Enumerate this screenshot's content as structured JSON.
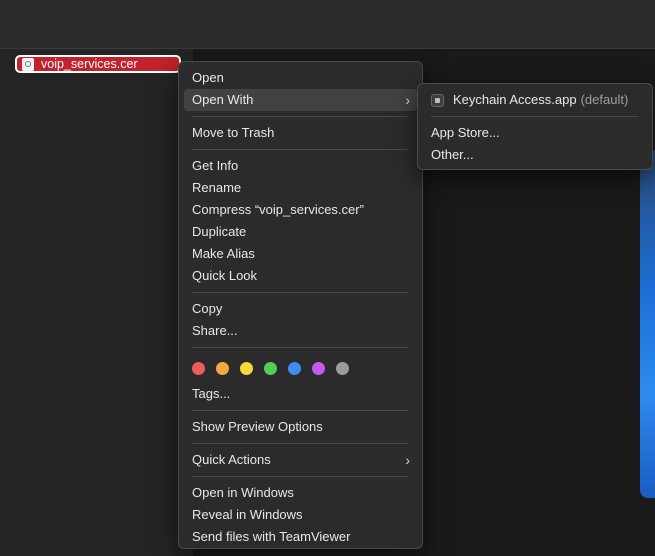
{
  "file": {
    "name": "voip_services.cer"
  },
  "context_menu": {
    "open": "Open",
    "open_with": "Open With",
    "move_to_trash": "Move to Trash",
    "get_info": "Get Info",
    "rename": "Rename",
    "compress": "Compress “voip_services.cer”",
    "duplicate": "Duplicate",
    "make_alias": "Make Alias",
    "quick_look": "Quick Look",
    "copy": "Copy",
    "share": "Share...",
    "tags": "Tags...",
    "tag_colors": [
      "#f05a5a",
      "#f5a93b",
      "#f7d93a",
      "#4fcf55",
      "#3f8cf5",
      "#c35bf0",
      "#9b9b9b"
    ],
    "show_preview_options": "Show Preview Options",
    "quick_actions": "Quick Actions",
    "open_in_windows": "Open in Windows",
    "reveal_in_windows": "Reveal in Windows",
    "send_with_teamviewer": "Send files with TeamViewer"
  },
  "open_with_submenu": {
    "keychain_app": "Keychain Access.app",
    "default_tag": "(default)",
    "app_store": "App Store...",
    "other": "Other..."
  }
}
